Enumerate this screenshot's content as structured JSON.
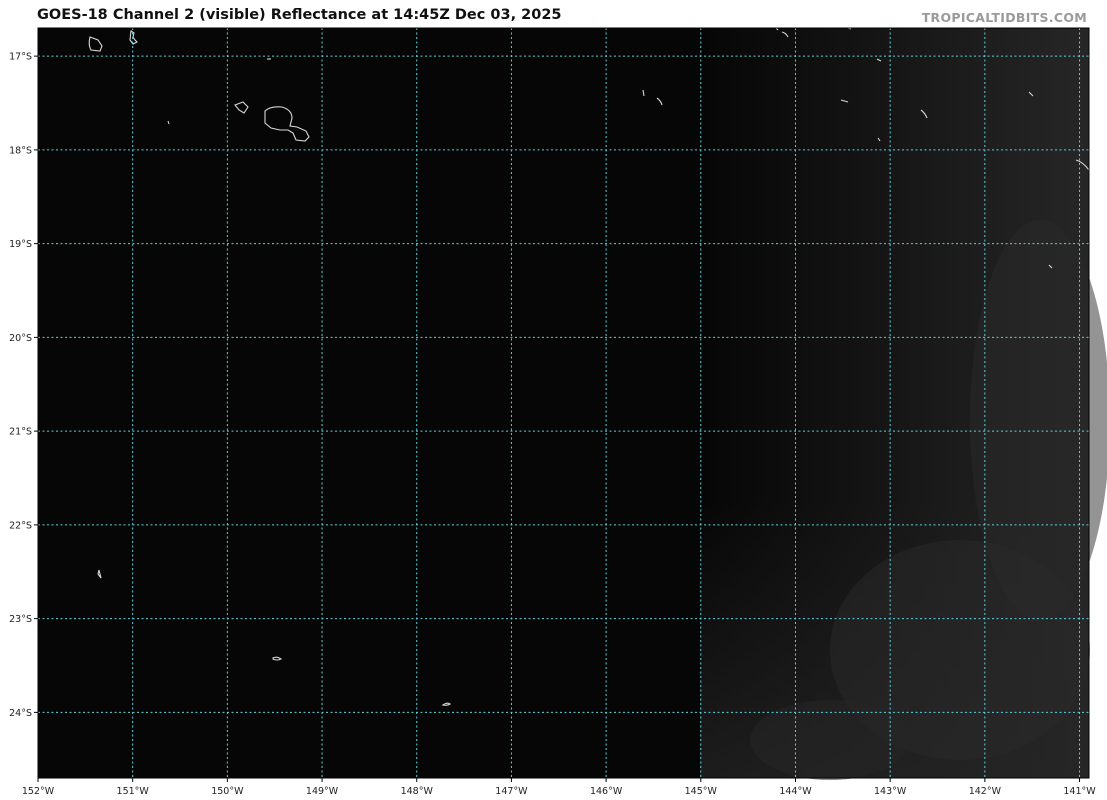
{
  "title": "GOES-18 Channel 2 (visible) Reflectance at 14:45Z Dec 03, 2025",
  "credit": "TROPICALTIDBITS.COM",
  "map": {
    "product": "visible-reflectance",
    "lon_range": [
      -152.0,
      -140.9
    ],
    "lat_range": [
      -24.7,
      -16.7
    ],
    "gridline_color": "#5fd3e0",
    "coastline_color": "#d8d8d8",
    "background_color": "#060606",
    "lat_labels": [
      {
        "label": "17°S",
        "value": -17
      },
      {
        "label": "18°S",
        "value": -18
      },
      {
        "label": "19°S",
        "value": -19
      },
      {
        "label": "20°S",
        "value": -20
      },
      {
        "label": "21°S",
        "value": -21
      },
      {
        "label": "22°S",
        "value": -22
      },
      {
        "label": "23°S",
        "value": -23
      },
      {
        "label": "24°S",
        "value": -24
      }
    ],
    "lon_labels": [
      {
        "label": "152°W",
        "value": -152
      },
      {
        "label": "151°W",
        "value": -151
      },
      {
        "label": "150°W",
        "value": -150
      },
      {
        "label": "149°W",
        "value": -149
      },
      {
        "label": "148°W",
        "value": -148
      },
      {
        "label": "147°W",
        "value": -147
      },
      {
        "label": "146°W",
        "value": -146
      },
      {
        "label": "145°W",
        "value": -145
      },
      {
        "label": "144°W",
        "value": -144
      },
      {
        "label": "143°W",
        "value": -143
      },
      {
        "label": "142°W",
        "value": -142
      },
      {
        "label": "141°W",
        "value": -141
      }
    ]
  }
}
